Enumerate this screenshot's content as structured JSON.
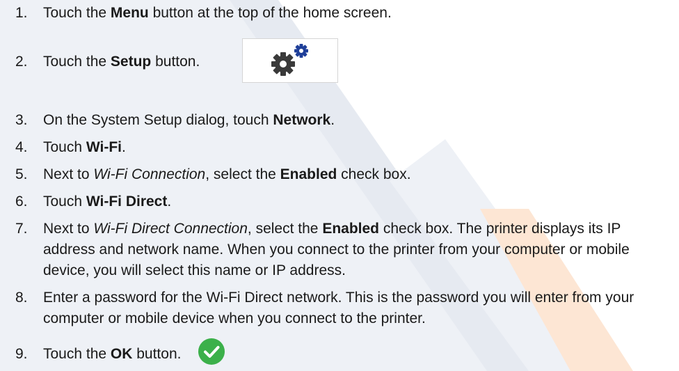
{
  "colors": {
    "text": "#1a1a1a",
    "watermark_gray": "#e3e7ee",
    "watermark_orange": "#fde3cf",
    "ok_green": "#3bb04a",
    "gear_dark": "#3a3a3a",
    "gear_blue": "#1f3f99"
  },
  "icons": {
    "setup": "gears-icon",
    "ok": "check-circle-icon"
  },
  "steps": [
    {
      "num": "1.",
      "parts": [
        "Touch the ",
        "Menu",
        " button at the top of the home screen."
      ]
    },
    {
      "num": "2.",
      "parts": [
        "Touch the ",
        "Setup",
        " button."
      ]
    },
    {
      "num": "3.",
      "parts": [
        "On the System Setup dialog, touch ",
        "Network",
        "."
      ]
    },
    {
      "num": "4.",
      "parts": [
        "Touch ",
        "Wi-Fi",
        "."
      ]
    },
    {
      "num": "5.",
      "parts": [
        "Next to ",
        "Wi-Fi Connection",
        ", select the ",
        "Enabled",
        " check box."
      ]
    },
    {
      "num": "6.",
      "parts": [
        "Touch ",
        "Wi-Fi Direct",
        "."
      ]
    },
    {
      "num": "7.",
      "parts": [
        "Next to ",
        "Wi-Fi Direct Connection",
        ", select the ",
        "Enabled",
        " check box. The printer displays its IP address and network name. When you connect to the printer from your computer or mobile device, you will select this name or IP address."
      ]
    },
    {
      "num": "8.",
      "parts": [
        "Enter a password for the Wi-Fi Direct network. This is the password you will enter from your computer or mobile device when you connect to the printer."
      ]
    },
    {
      "num": "9.",
      "parts": [
        "Touch the ",
        "OK",
        " button."
      ]
    }
  ]
}
